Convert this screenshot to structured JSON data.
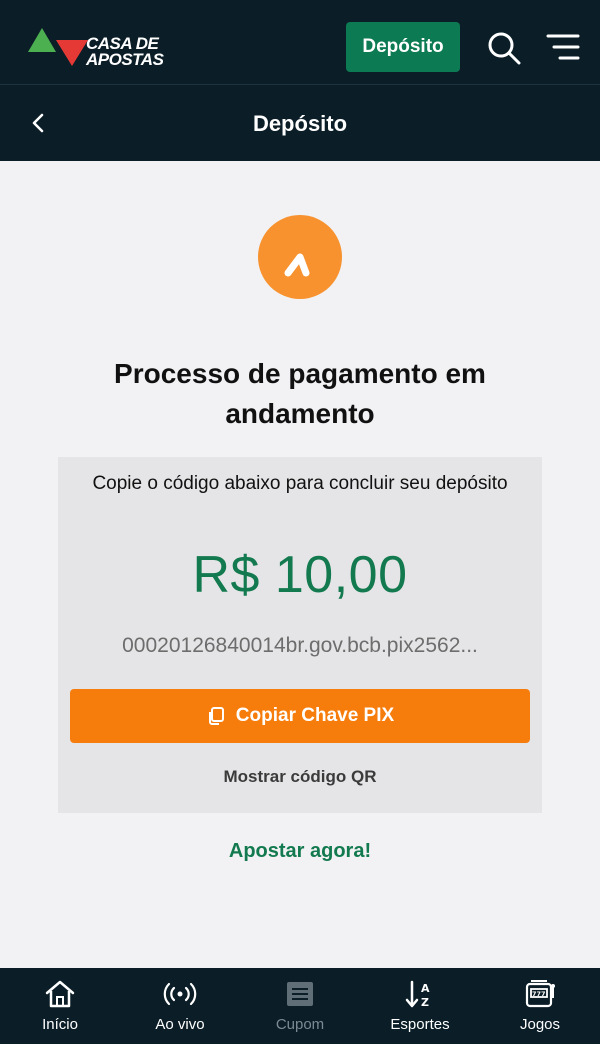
{
  "header": {
    "logo_text_line1": "CASA DE",
    "logo_text_line2": "APOSTAS",
    "deposit_button": "Depósito"
  },
  "subheader": {
    "title": "Depósito"
  },
  "payment": {
    "title": "Processo de pagamento em andamento",
    "instruction": "Copie o código abaixo para concluir seu depósito",
    "amount": "R$ 10,00",
    "pix_code": "00020126840014br.gov.bcb.pix2562...",
    "copy_button": "Copiar Chave PIX",
    "qr_link": "Mostrar código QR",
    "bet_link": "Apostar agora!"
  },
  "bottom_nav": {
    "items": [
      {
        "label": "Início",
        "icon": "home-icon"
      },
      {
        "label": "Ao vivo",
        "icon": "live-icon"
      },
      {
        "label": "Cupom",
        "icon": "coupon-icon"
      },
      {
        "label": "Esportes",
        "icon": "sports-sort-icon"
      },
      {
        "label": "Jogos",
        "icon": "slot-machine-icon"
      }
    ]
  },
  "colors": {
    "header_bg": "#0b1d27",
    "brand_green": "#0c7a52",
    "accent_orange": "#f67c0c",
    "amount_green": "#137a4f",
    "logo_circle": "#f7922e"
  }
}
